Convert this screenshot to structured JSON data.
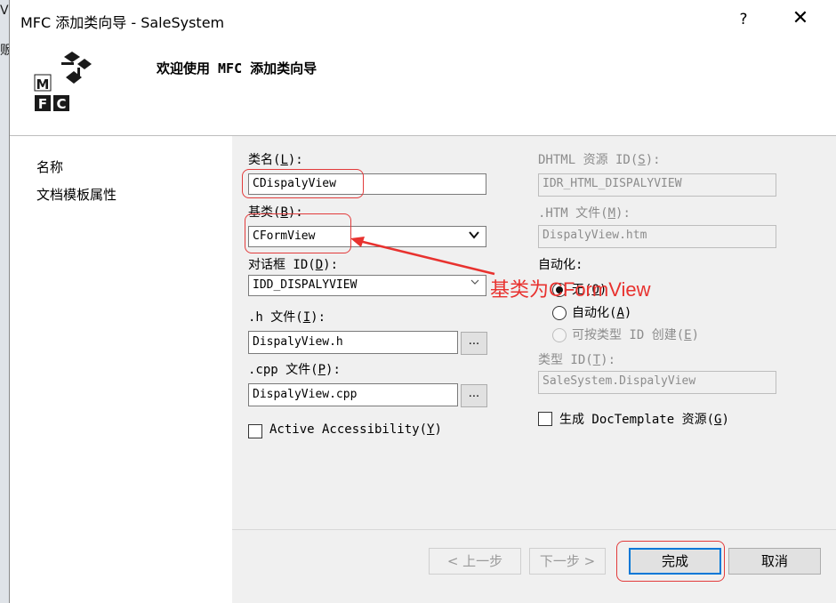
{
  "background": {
    "fragments": [
      "V",
      "贩"
    ]
  },
  "window": {
    "title": "MFC 添加类向导 - SaleSystem",
    "help": "?",
    "close": "✕"
  },
  "header": {
    "welcome": "欢迎使用 MFC 添加类向导",
    "logo_letters": [
      "M",
      "F",
      "C"
    ]
  },
  "nav": {
    "items": [
      "名称",
      "文档模板属性"
    ]
  },
  "form": {
    "class_name": {
      "label": "类名(",
      "key": "L",
      "suffix": "):",
      "value": "CDispalyView"
    },
    "base_class": {
      "label": "基类(",
      "key": "B",
      "suffix": "):",
      "value": "CFormView"
    },
    "dialog_id": {
      "label": "对话框 ID(",
      "key": "D",
      "suffix": "):",
      "value": "IDD_DISPALYVIEW"
    },
    "h_file": {
      "label": ".h 文件(",
      "key": "I",
      "suffix": "):",
      "value": "DispalyView.h",
      "browse": "..."
    },
    "cpp_file": {
      "label": ".cpp 文件(",
      "key": "P",
      "suffix": "):",
      "value": "DispalyView.cpp",
      "browse": "..."
    },
    "accessibility": {
      "label": "Active Accessibility(",
      "key": "Y",
      "suffix": ")",
      "checked": false
    },
    "dhtml_id": {
      "label": "DHTML 资源 ID(",
      "key": "S",
      "suffix": "):",
      "value": "IDR_HTML_DISPALYVIEW"
    },
    "htm_file": {
      "label": ".HTM 文件(",
      "key": "M",
      "suffix": "):",
      "value": "DispalyView.htm"
    },
    "automation": {
      "label": "自动化:",
      "options": [
        {
          "label": "无(",
          "key": "O",
          "suffix": ")",
          "selected": true,
          "enabled": true
        },
        {
          "label": "自动化(",
          "key": "A",
          "suffix": ")",
          "selected": false,
          "enabled": true
        },
        {
          "label": "可按类型 ID 创建(",
          "key": "E",
          "suffix": ")",
          "selected": false,
          "enabled": false
        }
      ]
    },
    "type_id": {
      "label": "类型 ID(",
      "key": "T",
      "suffix": "):",
      "value": "SaleSystem.DispalyView"
    },
    "doctemplate": {
      "label": "生成 DocTemplate 资源(",
      "key": "G",
      "suffix": ")",
      "checked": false
    }
  },
  "buttons": {
    "prev": "< 上一步",
    "next": "下一步 >",
    "finish": "完成",
    "cancel": "取消"
  },
  "annotation": {
    "text": "基类为CFormView",
    "color": "#e8322f"
  }
}
